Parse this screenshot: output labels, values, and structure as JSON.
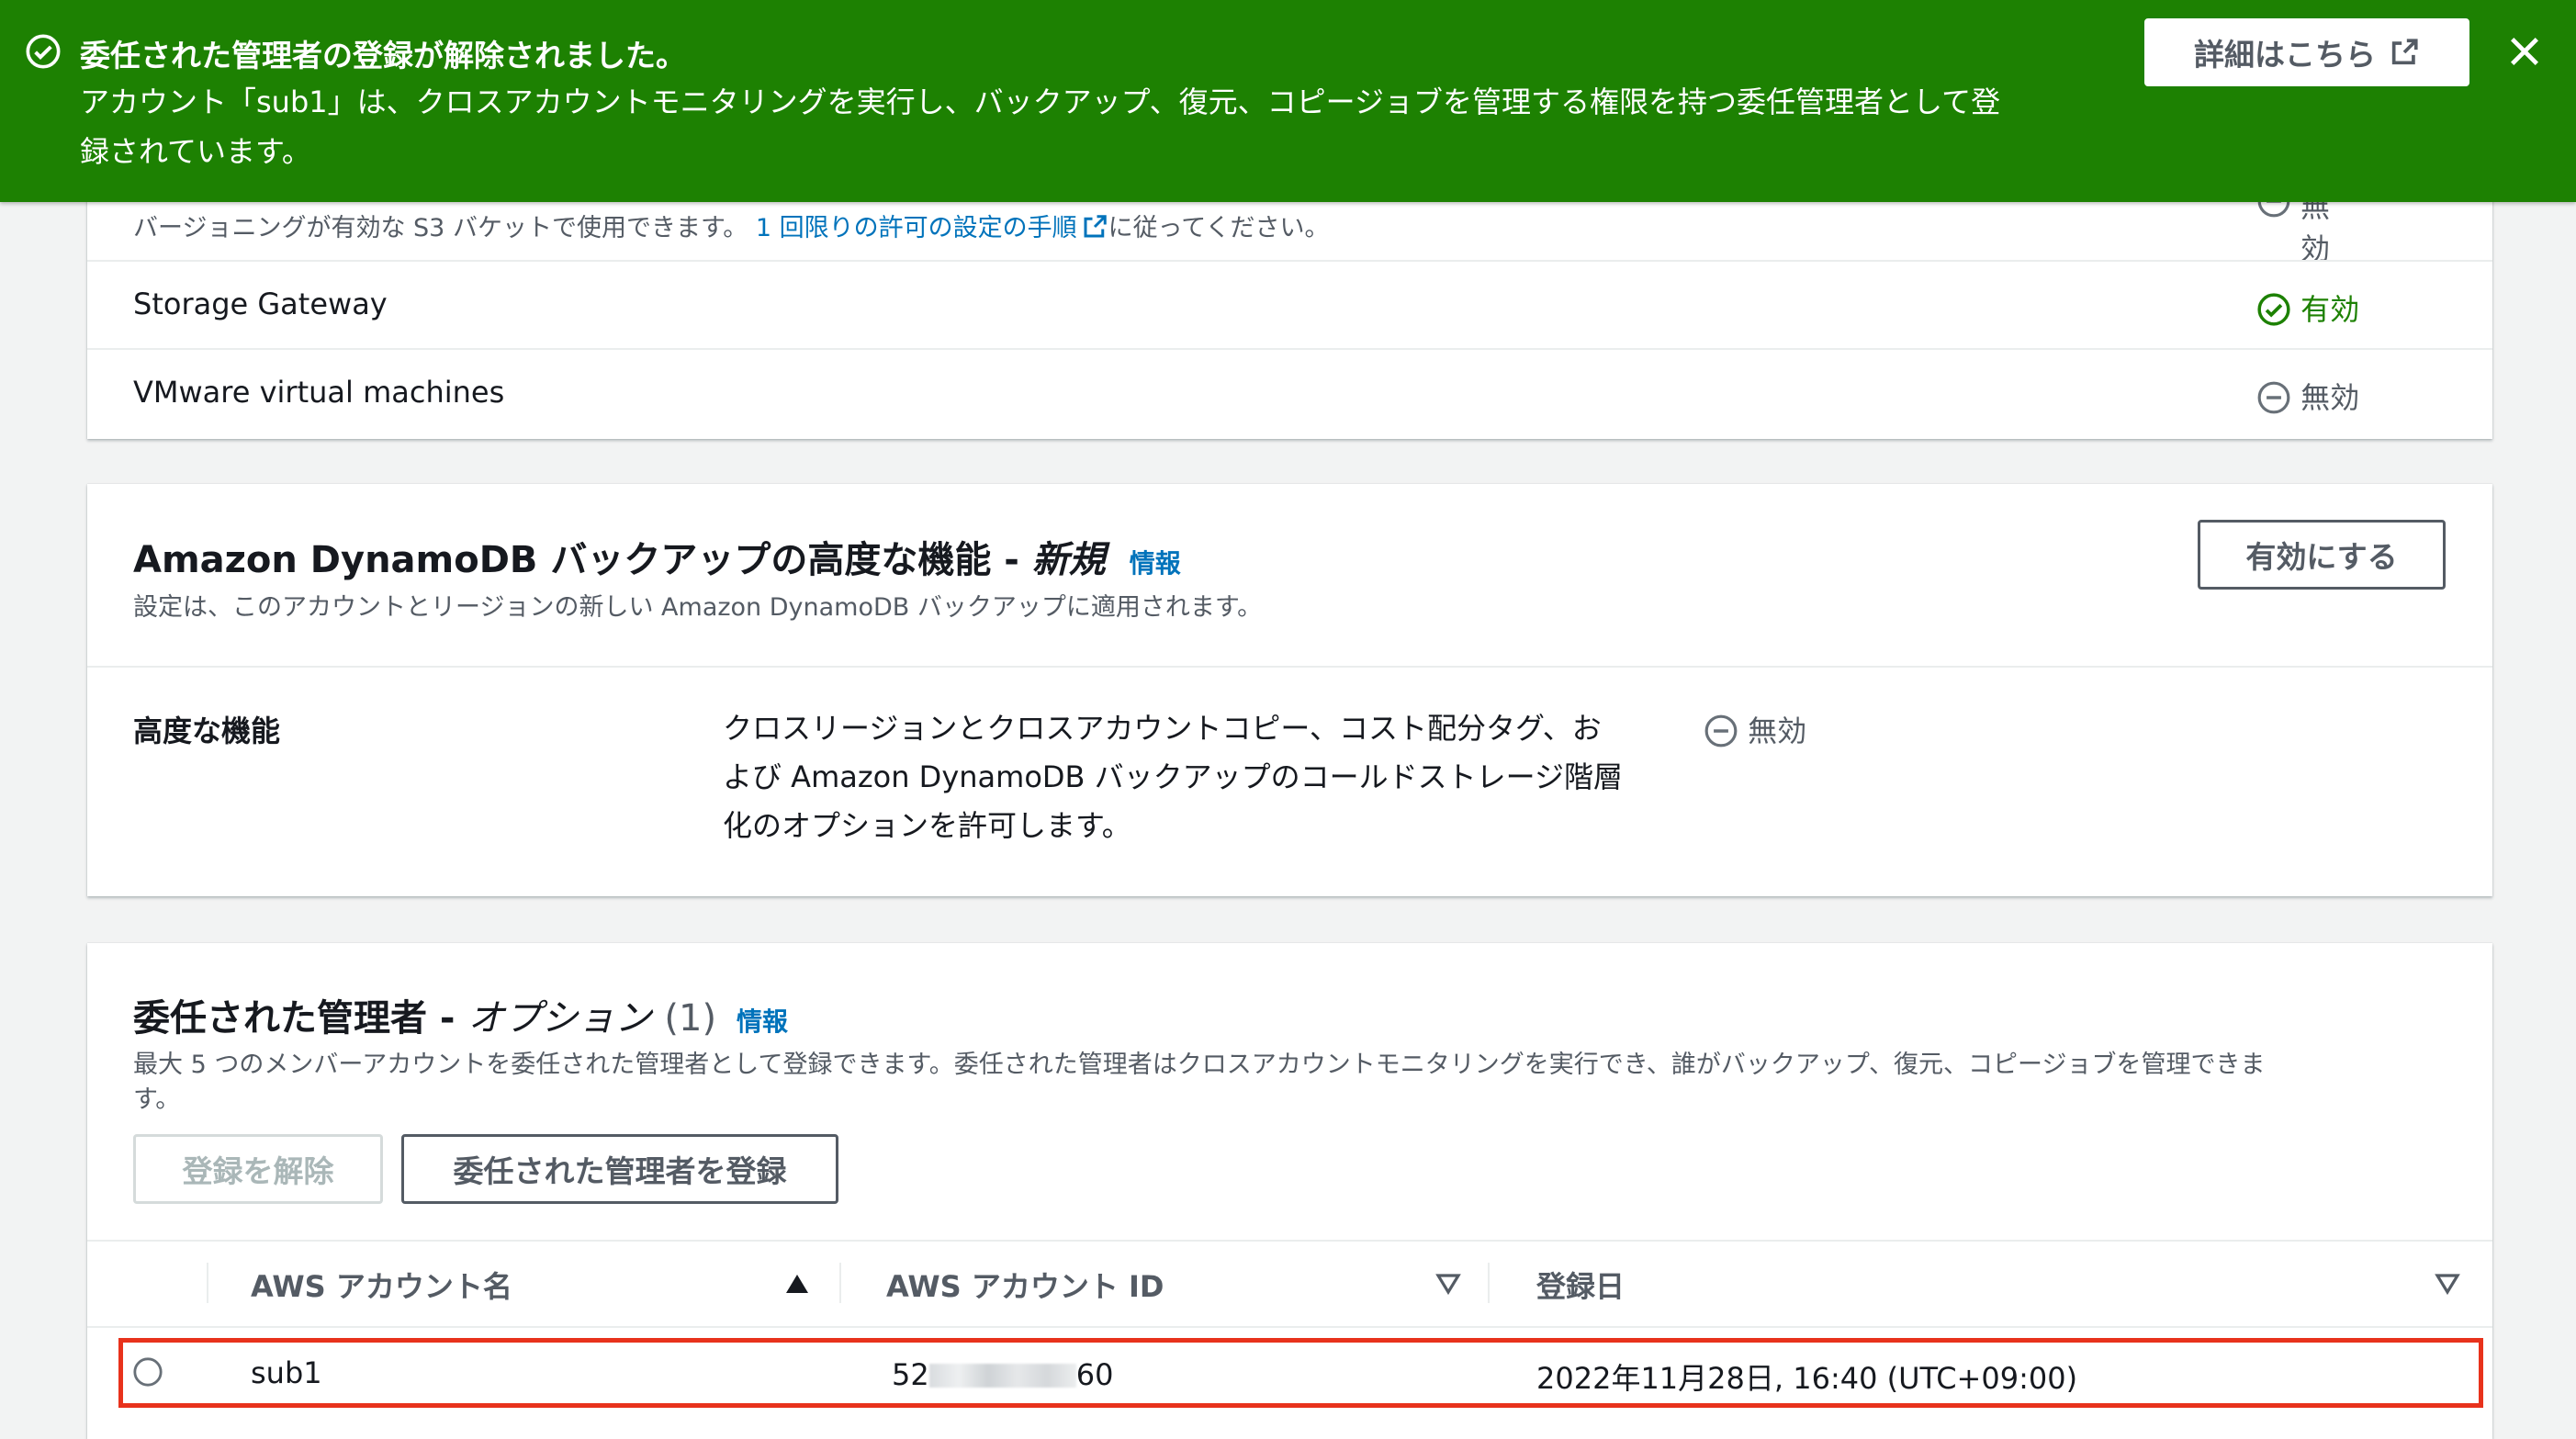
{
  "flash": {
    "title": "委任された管理者の登録が解除されました。",
    "message_line1": "アカウント「sub1」は、クロスアカウントモニタリングを実行し、バックアップ、復元、コピージョブを管理する権限を持つ委任管理者として登",
    "message_line2": "録されています。",
    "details_button": "詳細はこちら",
    "color": "#1d8102"
  },
  "resource_types": {
    "s3_note_prefix": "バージョニングが有効な S3 バケットで使用できます。",
    "s3_note_link": "1 回限りの許可の設定の手順",
    "s3_note_suffix": "に従ってください。",
    "s3_status_partial": "無効",
    "rows": [
      {
        "name": "Storage Gateway",
        "status": "有効",
        "status_icon": "check-circle-icon"
      },
      {
        "name": "VMware virtual machines",
        "status": "無効",
        "status_icon": "minus-circle-icon"
      }
    ]
  },
  "dynamodb": {
    "title": "Amazon DynamoDB バックアップの高度な機能 - ",
    "title_tag": "新規",
    "info": "情報",
    "description": "設定は、このアカウントとリージョンの新しい Amazon DynamoDB バックアップに適用されます。",
    "enable_button": "有効にする",
    "feature_label": "高度な機能",
    "feature_desc_line1": "クロスリージョンとクロスアカウントコピー、コスト配分タグ、お",
    "feature_desc_line2": "よび Amazon DynamoDB バックアップのコールドストレージ階層",
    "feature_desc_line3": "化のオプションを許可します。",
    "feature_status": "無効"
  },
  "delegated": {
    "title": "委任された管理者 - ",
    "title_optional": "オプション",
    "count": "(1)",
    "info": "情報",
    "description_line1": "最大 5 つのメンバーアカウントを委任された管理者として登録できます。委任された管理者はクロスアカウントモニタリングを実行でき、誰がバックアップ、復元、コピージョブを管理できま",
    "description_line2": "す。",
    "deregister_button": "登録を解除",
    "register_button": "委任された管理者を登録",
    "columns": [
      "AWS アカウント名",
      "AWS アカウント ID",
      "登録日"
    ],
    "rows": [
      {
        "name": "sub1",
        "id_prefix": "52",
        "id_suffix": "60",
        "date": "2022年11月28日, 16:40 (UTC+09:00)"
      }
    ],
    "highlight_color": "#e8321c"
  }
}
